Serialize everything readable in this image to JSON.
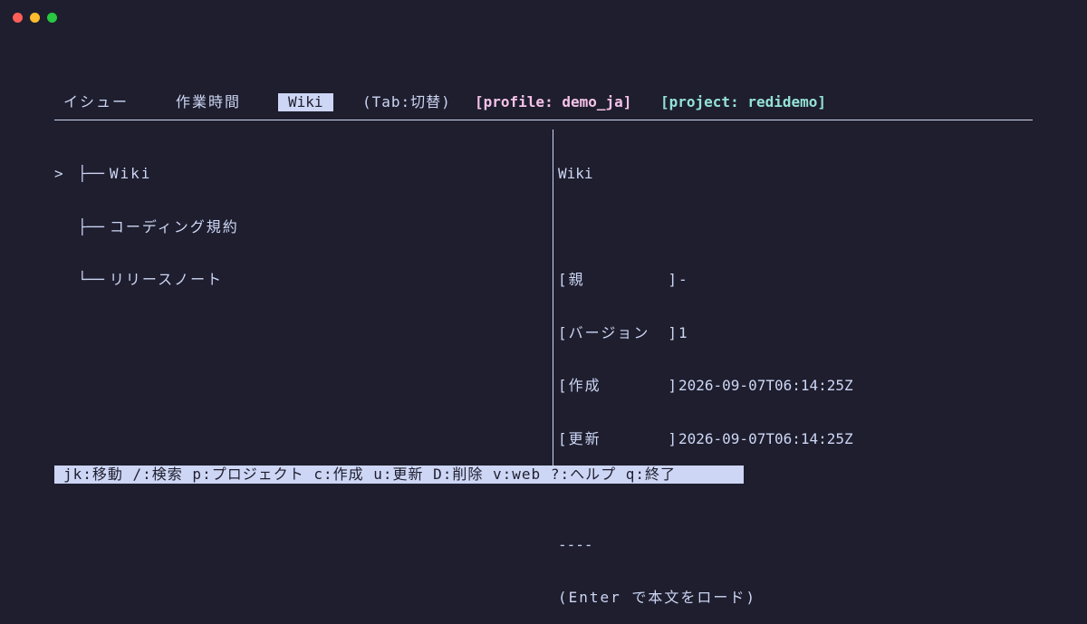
{
  "window": {
    "controls": [
      "close",
      "minimize",
      "zoom"
    ]
  },
  "tabs": {
    "items": [
      {
        "label": "イシュー",
        "active": false
      },
      {
        "label": "作業時間",
        "active": false
      },
      {
        "label": "Wiki",
        "active": true
      }
    ],
    "hint": "(Tab:切替)",
    "profile": "[profile: demo_ja]",
    "project": "[project: redidemo]"
  },
  "tree": {
    "cursor": ">",
    "items": [
      {
        "branch": "├──",
        "label": "Wiki",
        "selected": true
      },
      {
        "branch": "├──",
        "label": "コーディング規約",
        "selected": false
      },
      {
        "branch": "└──",
        "label": "リリースノート",
        "selected": false
      }
    ]
  },
  "detail": {
    "title": "Wiki",
    "fields": [
      {
        "key": "親",
        "value": "-"
      },
      {
        "key": "バージョン",
        "value": "1"
      },
      {
        "key": "作成",
        "value": "2026-09-07T06:14:25Z"
      },
      {
        "key": "更新",
        "value": "2026-09-07T06:14:25Z"
      }
    ],
    "separator": "----",
    "load_hint": "(Enter で本文をロード)"
  },
  "statusbar": {
    "text": "jk:移動 /:検索 p:プロジェクト c:作成 u:更新 D:削除 v:web ?:ヘルプ q:終了"
  },
  "colors": {
    "background": "#1e1e2e",
    "foreground": "#cdd6f4",
    "profile": "#f5c2e7",
    "project": "#94e2d5"
  }
}
